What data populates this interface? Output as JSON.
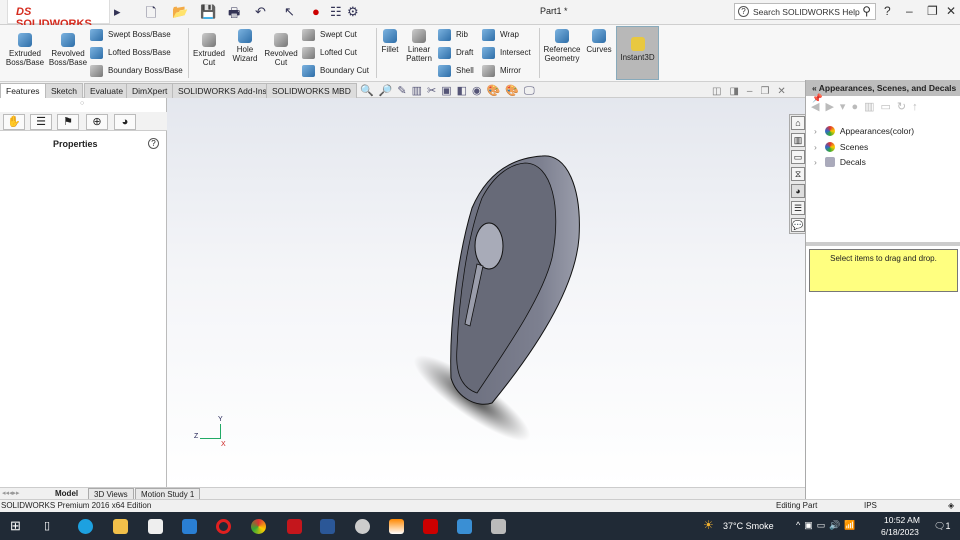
{
  "app": {
    "logo": "SOLIDWORKS",
    "document_title": "Part1 *",
    "search_placeholder": "Search SOLIDWORKS Help",
    "help": "?"
  },
  "quick_access": [
    "new-icon",
    "open-icon",
    "save-icon",
    "print-icon",
    "undo-icon",
    "select-icon",
    "rebuild-icon",
    "file-properties-icon",
    "options-icon"
  ],
  "ribbon": {
    "extruded_boss": "Extruded Boss/Base",
    "revolved_boss": "Revolved Boss/Base",
    "swept_boss": "Swept Boss/Base",
    "lofted_boss": "Lofted Boss/Base",
    "boundary_boss": "Boundary Boss/Base",
    "extruded_cut": "Extruded Cut",
    "hole_wizard": "Hole Wizard",
    "revolved_cut": "Revolved Cut",
    "swept_cut": "Swept Cut",
    "lofted_cut": "Lofted Cut",
    "boundary_cut": "Boundary Cut",
    "fillet": "Fillet",
    "linear_pattern": "Linear Pattern",
    "rib": "Rib",
    "draft": "Draft",
    "shell": "Shell",
    "wrap": "Wrap",
    "intersect": "Intersect",
    "mirror": "Mirror",
    "reference_geometry": "Reference Geometry",
    "curves": "Curves",
    "instant3d": "Instant3D"
  },
  "tabs": [
    "Features",
    "Sketch",
    "Evaluate",
    "DimXpert",
    "SOLIDWORKS Add-Ins",
    "SOLIDWORKS MBD"
  ],
  "left_panel": {
    "title": "Properties"
  },
  "triad": {
    "x": "X",
    "y": "Y",
    "z": "Z"
  },
  "right_panel": {
    "title": "Appearances, Scenes, and Decals",
    "items": [
      "Appearances(color)",
      "Scenes",
      "Decals"
    ],
    "hint": "Select items to drag and drop."
  },
  "bottom_tabs": [
    "Model",
    "3D Views",
    "Motion Study 1"
  ],
  "status": {
    "edition": "SOLIDWORKS Premium 2016 x64 Edition",
    "mode": "Editing Part",
    "units": "IPS"
  },
  "taskbar": {
    "weather": "37°C  Smoke",
    "time": "10:52 AM",
    "date": "6/18/2023",
    "notifications": "1"
  },
  "colors": {
    "brand": "#d52b1e",
    "tip": "#ffff80",
    "part": "#6e7180"
  }
}
